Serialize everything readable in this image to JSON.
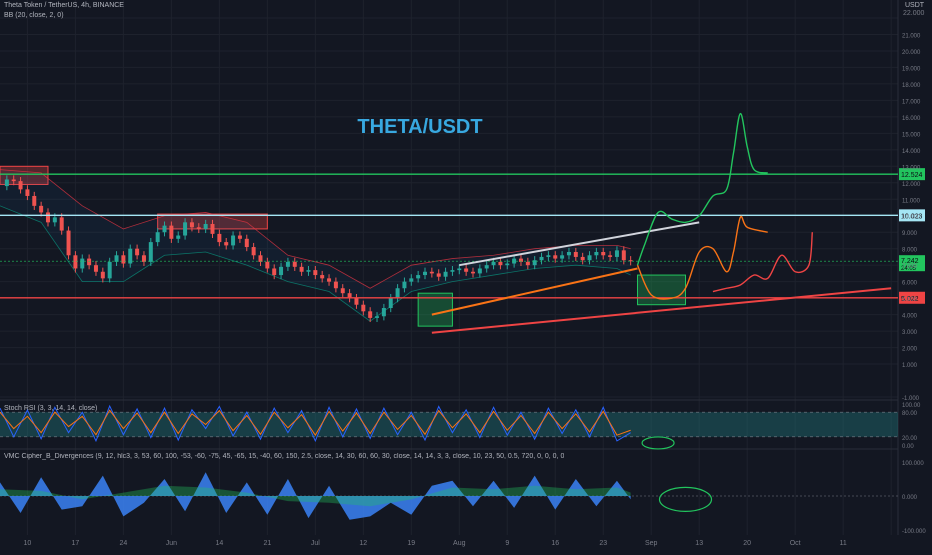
{
  "header": {
    "symbol_line": "Theta Token / TetherUS, 4h, BINANCE",
    "indicator_line": "BB (20, close, 2, 0)",
    "currency": "USDT"
  },
  "chart_data": [
    {
      "type": "line",
      "title": "THETA/USDT",
      "y_axis": {
        "min": -1,
        "max": 22,
        "ticks": [
          -1,
          1,
          2,
          3,
          4,
          5,
          6,
          7,
          8,
          9,
          10,
          11,
          12,
          13,
          14,
          15,
          16,
          17,
          18,
          19,
          20,
          21,
          22
        ],
        "tick_labels": [
          "-1.000",
          "1.000",
          "2.000",
          "3.000",
          "4.000",
          "5.000",
          "6.000",
          "7.000",
          "8.000",
          "9.000",
          "10.000",
          "11.000",
          "12.000",
          "13.000",
          "14.000",
          "15.000",
          "16.000",
          "17.000",
          "18.000",
          "19.000",
          "20.000",
          "21.000",
          "22.000"
        ]
      },
      "x_axis": {
        "min": 0,
        "max": 131,
        "ticks": [
          4,
          11,
          18,
          25,
          32,
          39,
          46,
          53,
          60,
          67,
          74,
          81,
          88,
          95,
          102,
          109,
          116,
          123,
          130
        ],
        "tick_labels": [
          "10",
          "17",
          "24",
          "Jun",
          "14",
          "21",
          "Jul",
          "12",
          "19",
          "Aug",
          "9",
          "16",
          "23",
          "Sep",
          "13",
          "20",
          "Oct",
          "11",
          ""
        ]
      },
      "price_series": {
        "name": "THETA/USDT 4h close",
        "x": [
          0,
          1,
          2,
          3,
          4,
          5,
          6,
          7,
          8,
          9,
          10,
          11,
          12,
          13,
          14,
          15,
          16,
          17,
          18,
          19,
          20,
          21,
          22,
          23,
          24,
          25,
          26,
          27,
          28,
          29,
          30,
          31,
          32,
          33,
          34,
          35,
          36,
          37,
          38,
          39,
          40,
          41,
          42,
          43,
          44,
          45,
          46,
          47,
          48,
          49,
          50,
          51,
          52,
          53,
          54,
          55,
          56,
          57,
          58,
          59,
          60,
          61,
          62,
          63,
          64,
          65,
          66,
          67,
          68,
          69,
          70,
          71,
          72,
          73,
          74,
          75,
          76,
          77,
          78,
          79,
          80,
          81,
          82,
          83,
          84,
          85,
          86,
          87,
          88,
          89,
          90,
          91,
          92
        ],
        "y": [
          11.8,
          12.2,
          12.1,
          11.6,
          11.2,
          10.6,
          10.2,
          9.6,
          9.9,
          9.1,
          7.6,
          6.8,
          7.4,
          7.0,
          6.6,
          6.2,
          7.2,
          7.6,
          7.1,
          8.0,
          7.6,
          7.2,
          8.4,
          9.0,
          9.4,
          8.6,
          8.8,
          9.6,
          9.3,
          9.2,
          9.5,
          8.9,
          8.4,
          8.2,
          8.8,
          8.6,
          8.1,
          7.6,
          7.2,
          6.8,
          6.4,
          6.9,
          7.2,
          6.9,
          6.6,
          6.7,
          6.4,
          6.2,
          6.0,
          5.6,
          5.3,
          5.0,
          4.6,
          4.2,
          3.8,
          3.9,
          4.4,
          5.0,
          5.6,
          6.0,
          6.2,
          6.4,
          6.6,
          6.5,
          6.3,
          6.6,
          6.7,
          6.8,
          6.6,
          6.5,
          6.8,
          7.0,
          7.2,
          7.0,
          7.1,
          7.4,
          7.2,
          7.0,
          7.3,
          7.5,
          7.6,
          7.4,
          7.6,
          7.8,
          7.5,
          7.3,
          7.6,
          7.8,
          7.6,
          7.5,
          7.9,
          7.3,
          7.24
        ]
      },
      "bollinger_upper": {
        "x": [
          0,
          6,
          12,
          18,
          24,
          30,
          36,
          42,
          48,
          54,
          60,
          66,
          72,
          78,
          84,
          90,
          92
        ],
        "y": [
          12.8,
          12.6,
          10.6,
          9.2,
          10.0,
          10.2,
          9.6,
          7.6,
          7.0,
          5.6,
          7.0,
          7.4,
          7.6,
          8.0,
          8.2,
          8.2,
          8.0
        ]
      },
      "bollinger_lower": {
        "x": [
          0,
          6,
          12,
          18,
          24,
          30,
          36,
          42,
          48,
          54,
          60,
          66,
          72,
          78,
          84,
          90,
          92
        ],
        "y": [
          10.6,
          9.6,
          6.0,
          6.0,
          7.6,
          7.8,
          7.0,
          6.0,
          5.4,
          3.6,
          5.4,
          6.0,
          6.4,
          6.8,
          7.0,
          6.8,
          6.4
        ]
      },
      "horizontal_levels": [
        {
          "value": 12.524,
          "label": "12.524",
          "color": "#22c55e"
        },
        {
          "value": 10.023,
          "label": "10.023",
          "color": "#a5e6f5"
        },
        {
          "value": 5.022,
          "label": "5.022",
          "color": "#ef4444"
        }
      ],
      "last_price": {
        "value": 7.242,
        "label": "7.242",
        "sublabel": "24:05",
        "color": "#22c55e"
      },
      "zones": [
        {
          "x0": 0,
          "x1": 7,
          "y0": 11.9,
          "y1": 13.0,
          "color": "#ef4444"
        },
        {
          "x0": 23,
          "x1": 39,
          "y0": 9.2,
          "y1": 10.1,
          "color": "#ef4444"
        },
        {
          "x0": 61,
          "x1": 66,
          "y0": 3.3,
          "y1": 5.3,
          "color": "#22c55e"
        },
        {
          "x0": 93,
          "x1": 100,
          "y0": 4.6,
          "y1": 6.4,
          "color": "#22c55e"
        }
      ],
      "trendlines": [
        {
          "x0": 67,
          "y0": 7.0,
          "x1": 102,
          "y1": 9.6,
          "color": "#d1d4dc"
        },
        {
          "x0": 63,
          "y0": 4.0,
          "x1": 93,
          "y1": 6.8,
          "color": "#f97316"
        },
        {
          "x0": 63,
          "y0": 2.9,
          "x1": 130,
          "y1": 5.6,
          "color": "#ef4444"
        }
      ],
      "projections": [
        {
          "color": "#22c55e",
          "points": [
            [
              93,
              7.0
            ],
            [
              94,
              8.2
            ],
            [
              96,
              10.2
            ],
            [
              98,
              9.8
            ],
            [
              100,
              9.6
            ],
            [
              102,
              10.0
            ],
            [
              104,
              11.2
            ],
            [
              106,
              11.6
            ],
            [
              107,
              13.8
            ],
            [
              108,
              16.2
            ],
            [
              109,
              14.2
            ],
            [
              110,
              12.8
            ],
            [
              112,
              12.6
            ]
          ]
        },
        {
          "color": "#f97316",
          "points": [
            [
              93,
              7.0
            ],
            [
              95,
              5.2
            ],
            [
              98,
              5.0
            ],
            [
              100,
              5.6
            ],
            [
              102,
              7.8
            ],
            [
              104,
              8.0
            ],
            [
              106,
              6.6
            ],
            [
              107,
              7.8
            ],
            [
              108,
              9.9
            ],
            [
              109,
              9.3
            ],
            [
              112,
              9.0
            ]
          ]
        },
        {
          "color": "#ef4444",
          "points": [
            [
              104,
              5.4
            ],
            [
              106,
              5.6
            ],
            [
              108,
              5.8
            ],
            [
              110,
              6.4
            ],
            [
              112,
              6.2
            ],
            [
              114,
              7.6
            ],
            [
              116,
              6.6
            ],
            [
              118,
              7.0
            ],
            [
              118.5,
              9.0
            ]
          ]
        }
      ]
    },
    {
      "type": "line",
      "title": "Stoch RSI (3, 3, 14, 14, close)",
      "y_axis": {
        "min": 0,
        "max": 100,
        "ticks": [
          0,
          20,
          80,
          100
        ],
        "tick_labels": [
          "0.00",
          "20.00",
          "80.00",
          "100.00"
        ]
      },
      "series": [
        {
          "name": "K",
          "color": "#2962ff",
          "x": [
            0,
            2,
            4,
            6,
            8,
            10,
            12,
            14,
            16,
            18,
            20,
            22,
            24,
            26,
            28,
            30,
            32,
            34,
            36,
            38,
            40,
            42,
            44,
            46,
            48,
            50,
            52,
            54,
            56,
            58,
            60,
            62,
            64,
            66,
            68,
            70,
            72,
            74,
            76,
            78,
            80,
            82,
            84,
            86,
            88,
            90,
            92
          ],
          "y": [
            90,
            20,
            85,
            15,
            92,
            30,
            80,
            10,
            95,
            25,
            88,
            18,
            90,
            12,
            86,
            40,
            94,
            22,
            80,
            14,
            90,
            30,
            84,
            10,
            92,
            20,
            88,
            16,
            90,
            25,
            80,
            12,
            94,
            30,
            86,
            18,
            92,
            24,
            80,
            14,
            90,
            28,
            86,
            20,
            92,
            10,
            30
          ]
        },
        {
          "name": "D",
          "color": "#f97316",
          "x": [
            0,
            2,
            4,
            6,
            8,
            10,
            12,
            14,
            16,
            18,
            20,
            22,
            24,
            26,
            28,
            30,
            32,
            34,
            36,
            38,
            40,
            42,
            44,
            46,
            48,
            50,
            52,
            54,
            56,
            58,
            60,
            62,
            64,
            66,
            68,
            70,
            72,
            74,
            76,
            78,
            80,
            82,
            84,
            86,
            88,
            90,
            92
          ],
          "y": [
            80,
            40,
            70,
            30,
            80,
            45,
            70,
            25,
            85,
            40,
            78,
            30,
            80,
            28,
            76,
            50,
            84,
            35,
            72,
            26,
            80,
            42,
            74,
            24,
            82,
            34,
            78,
            28,
            80,
            38,
            72,
            26,
            84,
            42,
            76,
            30,
            82,
            36,
            72,
            28,
            80,
            40,
            76,
            32,
            82,
            24,
            36
          ]
        }
      ]
    },
    {
      "type": "bar",
      "title": "VMC Cipher_B_Divergences (9, 12, hlc3, 3, 53, 60, 100, -53, -60, -75, 45, -65, 15, -40, 60, 150, 2.5, close, 14, 30, 60, 60, 30, close, 14, 14, 3, 3, close, 10, 23, 50, 0.5, 720, 0, 0, 0, 0, 0, 0, 60, 240, 0, 0, 240)",
      "y_axis": {
        "min": -100,
        "max": 100,
        "ticks": [
          -100,
          0,
          100
        ],
        "tick_labels": [
          "-100.000",
          "0.000",
          "100.000"
        ]
      },
      "series": [
        {
          "name": "WaveTrend",
          "color": "#3b82f6",
          "x": [
            0,
            3,
            6,
            9,
            12,
            15,
            18,
            21,
            24,
            27,
            30,
            33,
            36,
            39,
            42,
            45,
            48,
            51,
            54,
            57,
            60,
            63,
            66,
            69,
            72,
            75,
            78,
            81,
            84,
            87,
            90,
            92
          ],
          "y": [
            40,
            -50,
            55,
            -40,
            -30,
            60,
            -60,
            -20,
            50,
            -45,
            70,
            -50,
            40,
            -55,
            50,
            -65,
            30,
            -70,
            -60,
            -20,
            -55,
            30,
            45,
            -30,
            45,
            -35,
            60,
            -40,
            50,
            -30,
            45,
            -10
          ]
        },
        {
          "name": "Money Flow",
          "color": "#22c55e",
          "x": [
            0,
            6,
            12,
            18,
            24,
            30,
            36,
            42,
            48,
            54,
            60,
            66,
            72,
            78,
            84,
            90,
            92
          ],
          "y": [
            20,
            15,
            -10,
            10,
            30,
            25,
            10,
            -15,
            -20,
            -30,
            -10,
            25,
            20,
            30,
            20,
            25,
            10
          ]
        }
      ]
    }
  ],
  "axis_label_max_partial": "22.000"
}
